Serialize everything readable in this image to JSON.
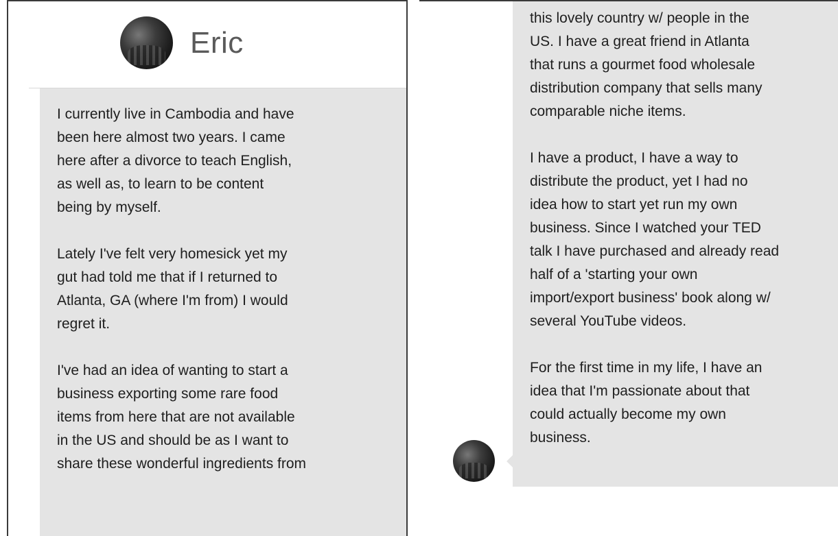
{
  "conversation": {
    "contact_name": "Eric",
    "avatar_icon": "profile-photo",
    "bubble_color": "#e4e4e4"
  },
  "left_panel": {
    "paragraphs": [
      "I currently live in Cambodia and have\nbeen here almost two years.  I came\nhere after a divorce to teach English,\nas well as, to learn to be content\nbeing by  myself.",
      "Lately I've felt very homesick yet my\ngut had told me that if I returned to\nAtlanta, GA (where I'm from) I would\nregret it.",
      "I've had an idea of wanting to start a\nbusiness exporting some rare food\nitems from here that are not available\nin the US and should be as I want to\nshare these wonderful ingredients from"
    ]
  },
  "right_panel": {
    "paragraphs": [
      "this lovely country w/ people in the\nUS.  I have a great friend in Atlanta\nthat runs a gourmet food wholesale\ndistribution company that sells many\ncomparable niche items.",
      "I have a product, I have a way to\ndistribute the product, yet I had no\nidea how to start yet run my own\nbusiness.  Since I watched your TED\ntalk I have purchased and already read\nhalf of a 'starting your own\nimport/export business' book along w/\nseveral YouTube videos.",
      "For the first time in my life, I have an\nidea that I'm passionate about that\ncould actually become my own\nbusiness."
    ]
  }
}
